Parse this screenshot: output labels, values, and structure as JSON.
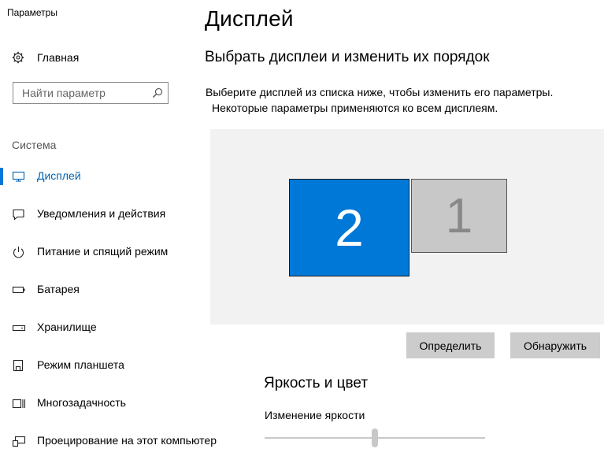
{
  "window": {
    "title": "Параметры"
  },
  "sidebar": {
    "home_label": "Главная",
    "search": {
      "placeholder": "Найти параметр",
      "value": ""
    },
    "section_label": "Система",
    "items": [
      {
        "label": "Дисплей",
        "icon": "monitor-icon",
        "active": true
      },
      {
        "label": "Уведомления и действия",
        "icon": "notification-icon",
        "active": false
      },
      {
        "label": "Питание и спящий режим",
        "icon": "power-icon",
        "active": false
      },
      {
        "label": "Батарея",
        "icon": "battery-icon",
        "active": false
      },
      {
        "label": "Хранилище",
        "icon": "storage-icon",
        "active": false
      },
      {
        "label": "Режим планшета",
        "icon": "tablet-mode-icon",
        "active": false
      },
      {
        "label": "Многозадачность",
        "icon": "multitasking-icon",
        "active": false
      },
      {
        "label": "Проецирование на этот компьютер",
        "icon": "projecting-icon",
        "active": false
      }
    ]
  },
  "main": {
    "title": "Дисплей",
    "arrange_heading": "Выбрать дисплеи и изменить их порядок",
    "description_line1": "Выберите дисплей из списка ниже, чтобы изменить его параметры.",
    "description_line2": "Некоторые параметры применяются ко всем дисплеям.",
    "monitors": [
      {
        "number": "2",
        "selected": true
      },
      {
        "number": "1",
        "selected": false
      }
    ],
    "identify_button": "Определить",
    "detect_button": "Обнаружить",
    "brightness_heading": "Яркость и цвет",
    "brightness_label": "Изменение яркости",
    "brightness_level": 0.5
  },
  "colors": {
    "accent": "#0078d7",
    "selected_monitor": "#0078d7",
    "unselected_monitor": "#c8c8c8",
    "arrange_background": "#f2f2f2",
    "button_background": "#cccccc"
  }
}
